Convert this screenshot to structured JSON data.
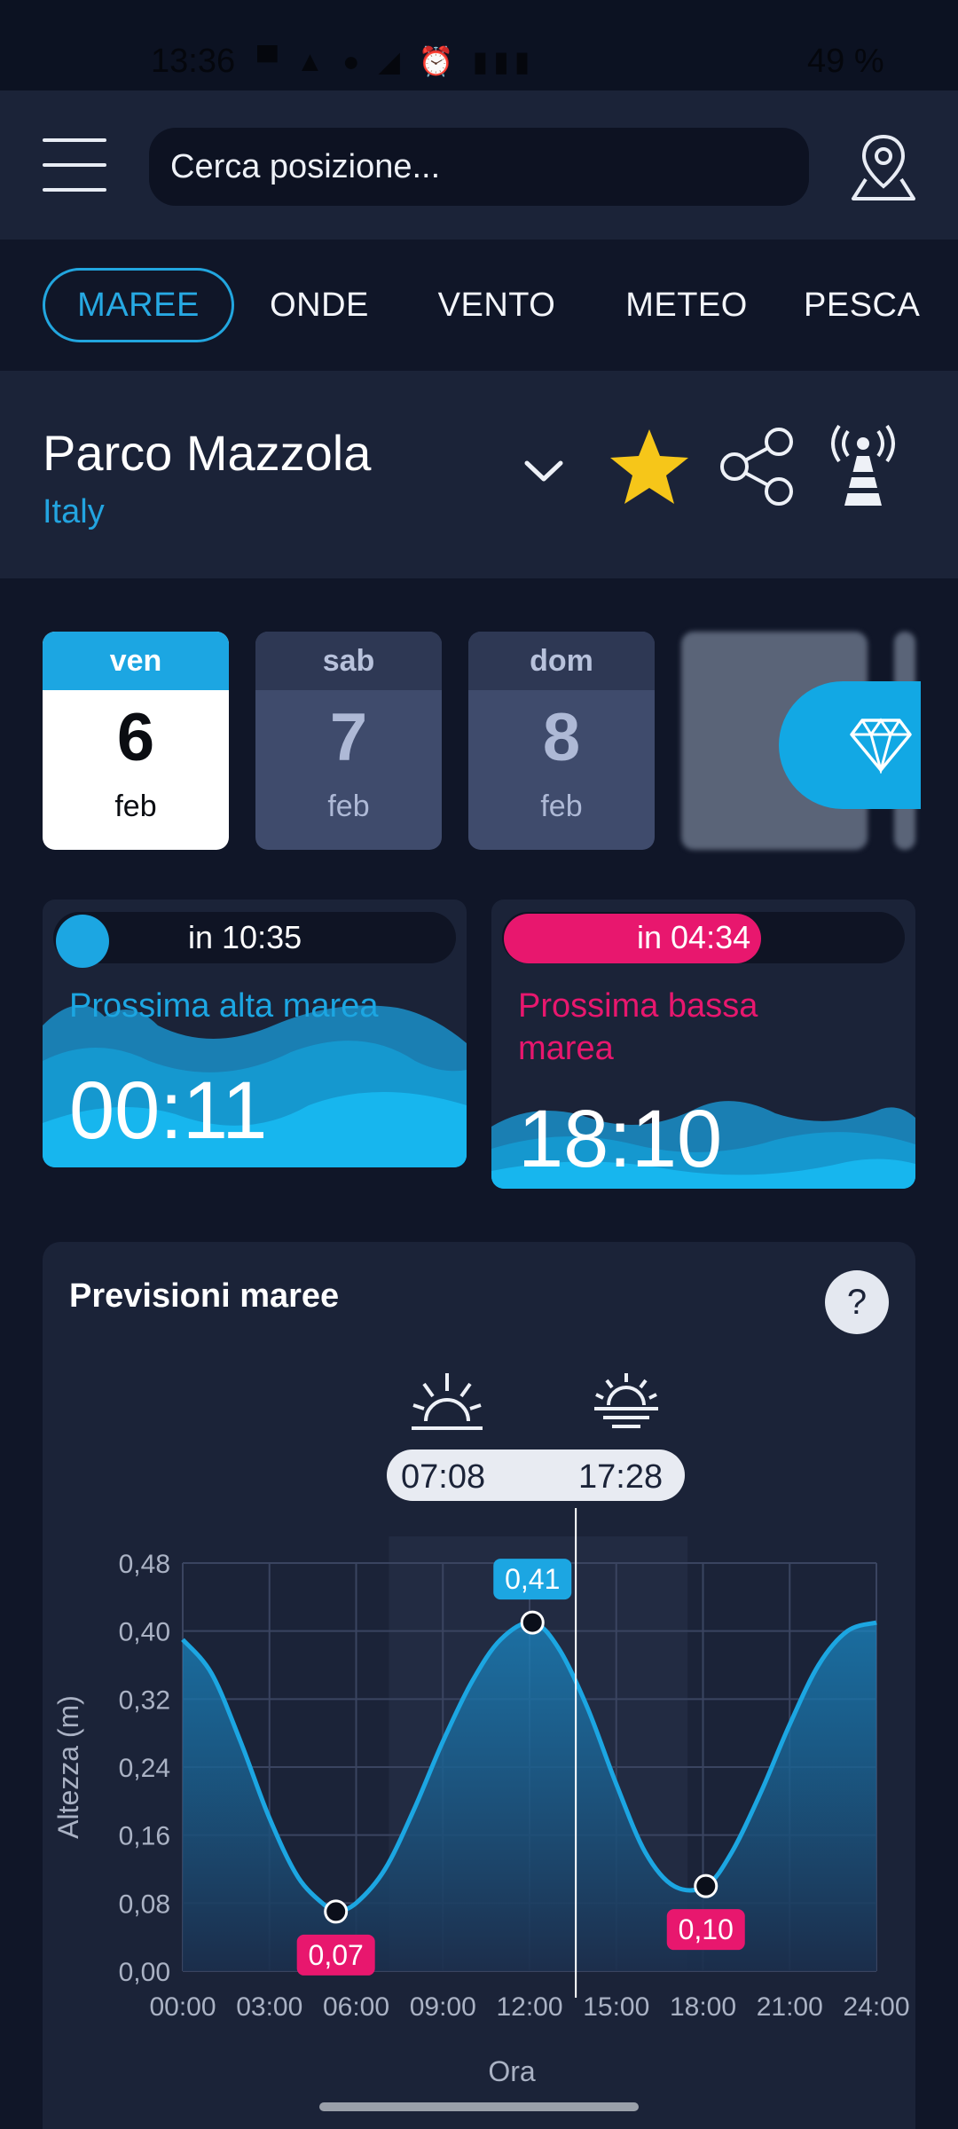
{
  "status_bar": {
    "time": "13:36",
    "battery": "49 %",
    "icons": [
      "message-icon",
      "vpn-icon",
      "alarm-icon",
      "signal-icon"
    ]
  },
  "header": {
    "search_placeholder": "Cerca posizione..."
  },
  "tabs": [
    {
      "label": "MAREE",
      "active": true
    },
    {
      "label": "ONDE",
      "active": false
    },
    {
      "label": "VENTO",
      "active": false
    },
    {
      "label": "METEO",
      "active": false
    },
    {
      "label": "PESCA",
      "active": false
    }
  ],
  "location": {
    "name": "Parco Mazzola",
    "country": "Italy"
  },
  "days": [
    {
      "dow": "ven",
      "day": "6",
      "month": "feb",
      "selected": true
    },
    {
      "dow": "sab",
      "day": "7",
      "month": "feb",
      "selected": false
    },
    {
      "dow": "dom",
      "day": "8",
      "month": "feb",
      "selected": false
    }
  ],
  "tides": {
    "high": {
      "countdown": "in 10:35",
      "label": "Prossima alta marea",
      "time": "00:11",
      "color": "#1ca6e2"
    },
    "low": {
      "countdown": "in 04:34",
      "label_line1": "Prossima bassa",
      "label_line2": "marea",
      "time": "18:10",
      "color": "#e8176e"
    }
  },
  "forecast": {
    "title": "Previsioni maree",
    "help": "?",
    "sunrise": "07:08",
    "sunset": "17:28"
  },
  "chart_data": {
    "type": "line",
    "title": "",
    "xlabel": "Ora",
    "ylabel": "Altezza (m)",
    "x_ticks": [
      "00:00",
      "03:00",
      "06:00",
      "09:00",
      "12:00",
      "15:00",
      "18:00",
      "21:00",
      "24:00"
    ],
    "y_ticks": [
      "0,00",
      "0,08",
      "0,16",
      "0,24",
      "0,32",
      "0,40",
      "0,48"
    ],
    "xlim": [
      0,
      24
    ],
    "ylim": [
      0,
      0.48
    ],
    "grid": true,
    "current_time_hours": 13.6,
    "series": [
      {
        "x": [
          0,
          1,
          2,
          3,
          4,
          5,
          5.3,
          6,
          7,
          8,
          9,
          10,
          11,
          12.1,
          13,
          14,
          15,
          16,
          17,
          18.1,
          19,
          20,
          21,
          22,
          23,
          24
        ],
        "y": [
          0.39,
          0.35,
          0.27,
          0.18,
          0.11,
          0.075,
          0.07,
          0.08,
          0.12,
          0.19,
          0.27,
          0.34,
          0.39,
          0.41,
          0.38,
          0.31,
          0.22,
          0.14,
          0.1,
          0.1,
          0.14,
          0.21,
          0.29,
          0.36,
          0.4,
          0.41
        ]
      }
    ],
    "extrema": [
      {
        "x": 5.3,
        "y": 0.07,
        "label": "0,07",
        "kind": "low"
      },
      {
        "x": 12.1,
        "y": 0.41,
        "label": "0,41",
        "kind": "high"
      },
      {
        "x": 18.1,
        "y": 0.1,
        "label": "0,10",
        "kind": "low"
      }
    ],
    "colors": {
      "line": "#1ca6e2",
      "low_badge": "#e8176e",
      "high_badge": "#1ca6e2"
    }
  }
}
